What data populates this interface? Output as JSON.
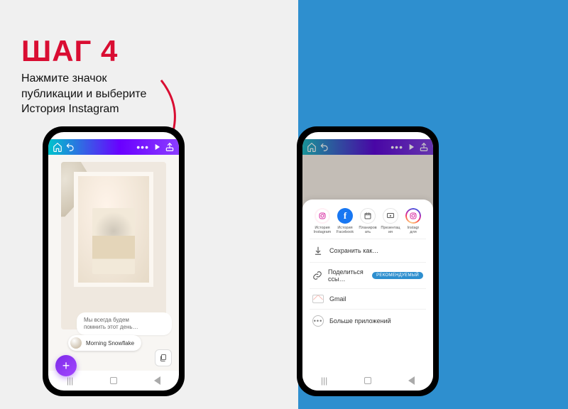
{
  "headline": "ШАГ 4",
  "subhead_l1": "Нажмите значок",
  "subhead_l2": "публикации и выберите",
  "subhead_l3": "История Instagram",
  "left": {
    "caption_l1": "Мы всегда будем",
    "caption_l2": "помнить этот день…",
    "user_name": "Morning Snowflake"
  },
  "share": {
    "items": [
      {
        "label_l1": "История",
        "label_l2": "Instagram"
      },
      {
        "label_l1": "История",
        "label_l2": "Facebook"
      },
      {
        "label_l1": "Планиров",
        "label_l2": "ать"
      },
      {
        "label_l1": "Презентац",
        "label_l2": "ия"
      },
      {
        "label_l1": "Instagr",
        "label_l2": "для"
      }
    ],
    "save_as": "Сохранить как…",
    "share_link": "Поделиться ссы…",
    "recommended": "РЕКОМЕНДУЕМЫЙ",
    "gmail": "Gmail",
    "more_apps": "Больше приложений"
  }
}
